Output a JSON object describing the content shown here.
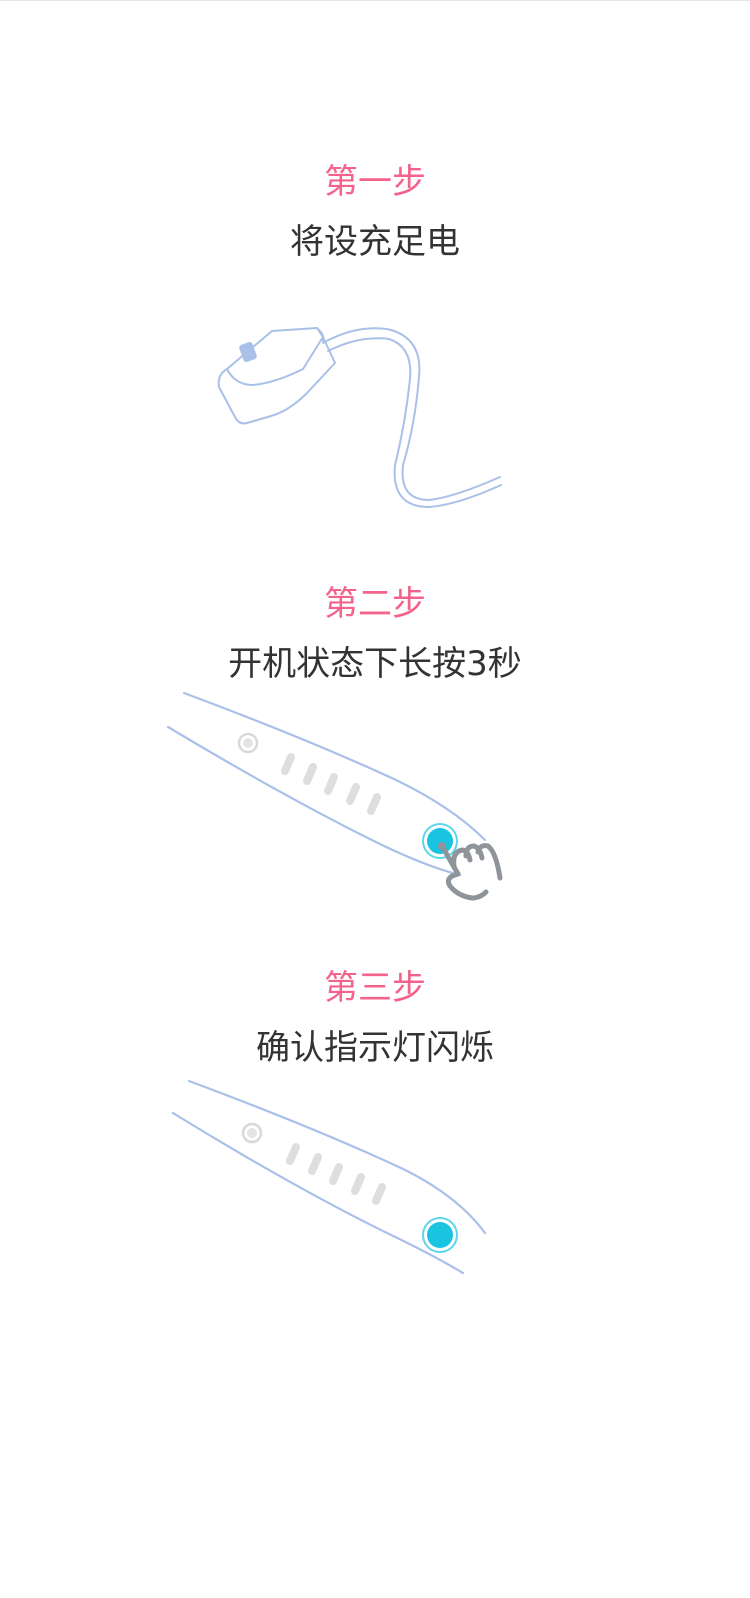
{
  "steps": [
    {
      "title": "第一步",
      "description": "将设充足电"
    },
    {
      "title": "第二步",
      "description": "开机状态下长按3秒"
    },
    {
      "title": "第三步",
      "description": "确认指示灯闪烁"
    }
  ],
  "colors": {
    "accent": "#f4638c",
    "text": "#333333",
    "outline": "#a9c0e8",
    "button": "#19c4e0",
    "hand": "#8f949a",
    "indicator": "#d8d8d8"
  },
  "icons": {
    "step1": "charger-cable-icon",
    "step2_device": "device-icon",
    "step2_hand": "hand-press-icon",
    "step3_device": "device-icon"
  }
}
